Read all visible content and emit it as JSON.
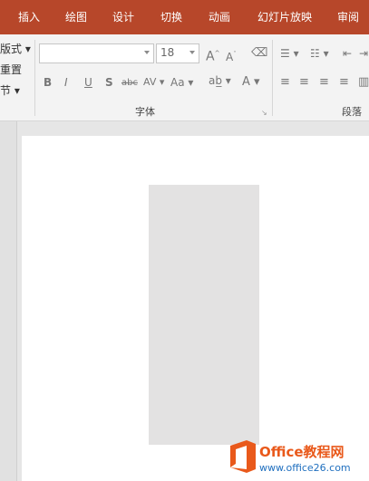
{
  "tabs": [
    "插入",
    "绘图",
    "设计",
    "切换",
    "动画",
    "幻灯片放映",
    "审阅"
  ],
  "left_group": {
    "items": [
      "版式",
      "重置",
      "节"
    ]
  },
  "font": {
    "name_value": "",
    "size_value": "18",
    "group_label": "字体"
  },
  "paragraph": {
    "group_label": "段落"
  },
  "watermark": {
    "title": "Office教程网",
    "url": "www.office26.com"
  },
  "colors": {
    "accent": "#b7472a",
    "ribbon": "#f3f3f3",
    "shape_fill": "#e3e2e2",
    "logo_orange": "#e9591b"
  }
}
